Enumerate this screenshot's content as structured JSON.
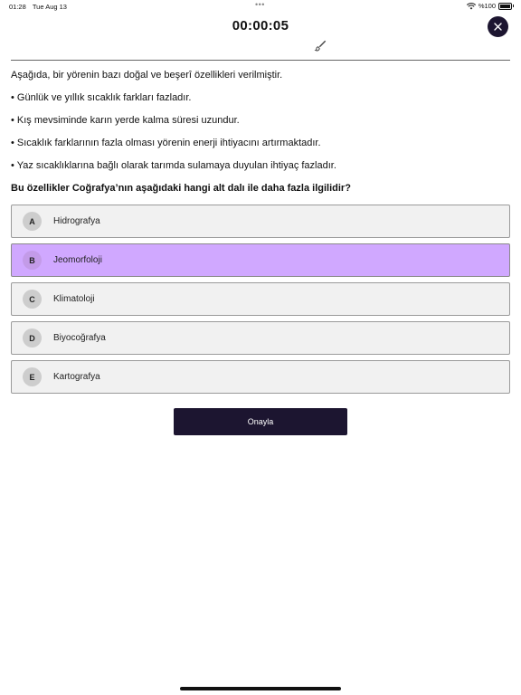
{
  "status_bar": {
    "time": "01:28",
    "date": "Tue Aug 13",
    "battery": "%100"
  },
  "header": {
    "timer": "00:00:05"
  },
  "question": {
    "intro": "Aşağıda, bir yörenin bazı doğal ve beşerî özellikleri verilmiştir.",
    "bullets": [
      "• Günlük ve yıllık sıcaklık farkları fazladır.",
      "• Kış mevsiminde karın yerde kalma süresi uzundur.",
      "• Sıcaklık farklarının fazla olması yörenin enerji ihtiyacını artırmaktadır.",
      "• Yaz sıcaklıklarına bağlı olarak tarımda sulamaya duyulan ihtiyaç fazladır."
    ],
    "prompt": "Bu özellikler Coğrafya’nın aşağıdaki hangi alt dalı ile daha fazla ilgilidir?"
  },
  "options": [
    {
      "letter": "A",
      "label": "Hidrografya"
    },
    {
      "letter": "B",
      "label": "Jeomorfoloji"
    },
    {
      "letter": "C",
      "label": "Klimatoloji"
    },
    {
      "letter": "D",
      "label": "Biyocoğrafya"
    },
    {
      "letter": "E",
      "label": "Kartografya"
    }
  ],
  "selected_option": "B",
  "confirm_button": {
    "label": "Onayla"
  },
  "colors": {
    "selected": "#d0a8ff",
    "dark": "#1c1530"
  }
}
